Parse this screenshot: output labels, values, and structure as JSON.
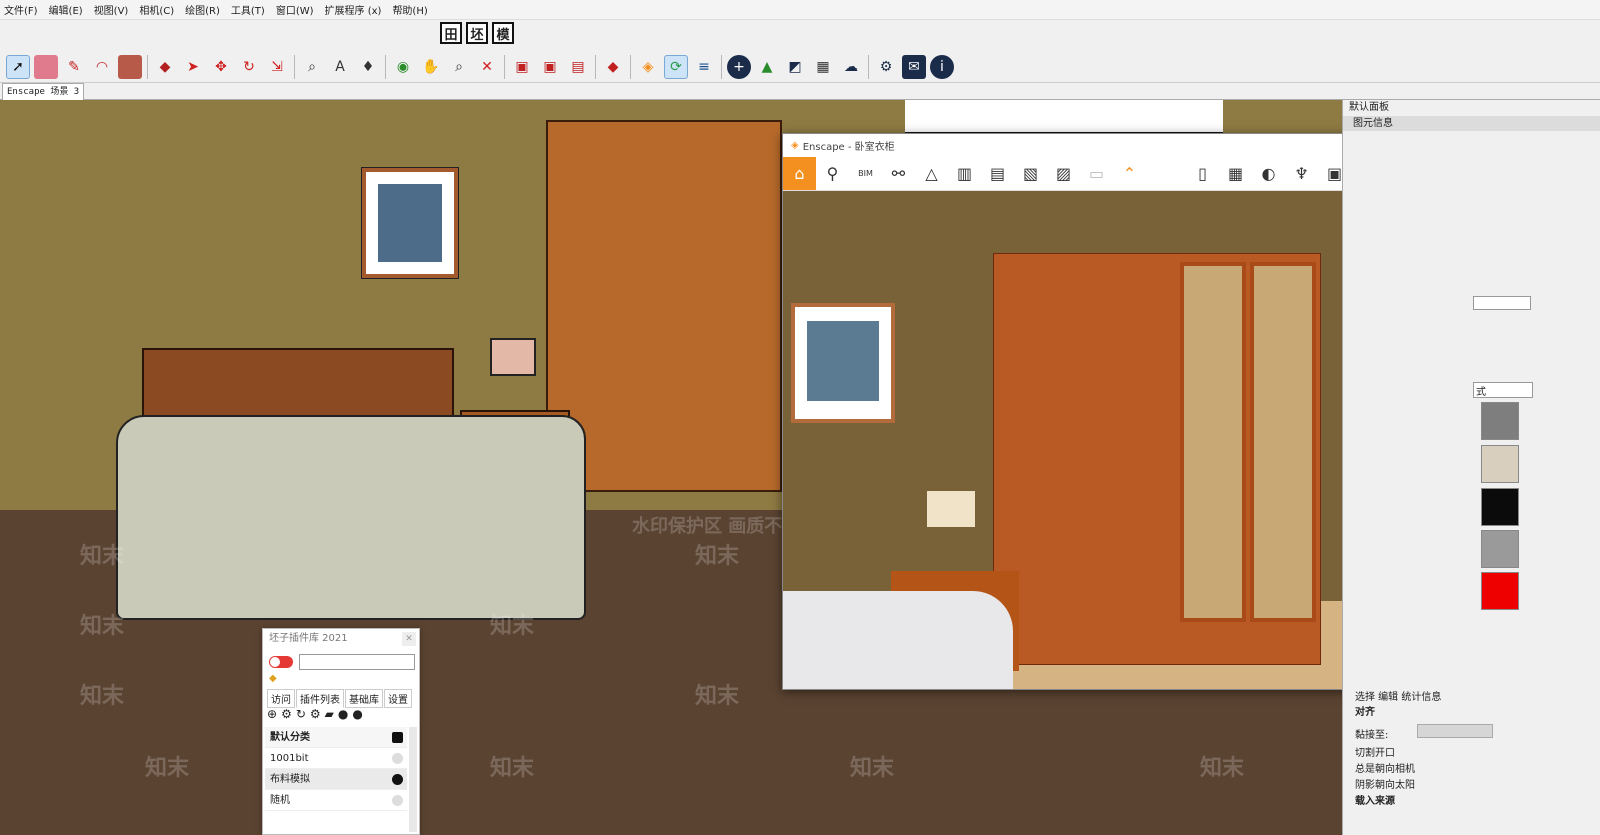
{
  "menu": [
    "文件(F)",
    "编辑(E)",
    "视图(V)",
    "相机(C)",
    "绘图(R)",
    "工具(T)",
    "窗口(W)",
    "扩展程序 (x)",
    "帮助(H)"
  ],
  "small_toolbar": [
    "田",
    "坯",
    "模"
  ],
  "scene_tab": "Enscape 场景 3",
  "watermarks": {
    "main": "水印保护区  画质不受到部分影响",
    "brand": "知末"
  },
  "enscape": {
    "title": "Enscape - 卧室衣柜",
    "bim_label": "BIM",
    "icons": [
      "home-icon",
      "route-icon",
      "bim-icon",
      "binoculars-icon",
      "walk-icon",
      "building-icon",
      "clapper-icon",
      "screenshot-icon",
      "batch-render-icon",
      "pano-icon",
      "map-icon",
      "export-icon",
      "section-icon",
      "asset-icon",
      "asset-library-icon",
      "eye-icon",
      "gear-icon",
      "help-icon"
    ]
  },
  "right_panel": {
    "header": "默认面板",
    "section": "图元信息",
    "tabs": "选择  编辑  统计信息",
    "align": "对齐",
    "glue_to": "黏接至:",
    "cut_opening": "切割开口",
    "face_camera": "总是朝向相机",
    "shadow_sun": "阴影朝向太阳",
    "load_source": "载入来源",
    "style_dropdown": "式",
    "swatch_colors": [
      "#7e7e7e",
      "#d9cfbf",
      "#0b0b0b",
      "#9a9a9a",
      "#ee0000"
    ]
  },
  "plugin": {
    "title": "坯子插件库 2021",
    "tabs": [
      "访问",
      "插件列表",
      "基础库",
      "设置"
    ],
    "list": [
      {
        "label": "默认分类",
        "checked": true
      },
      {
        "label": "1001bit",
        "checked": false
      },
      {
        "label": "布料模拟",
        "checked": true
      },
      {
        "label": "随机",
        "checked": false
      }
    ]
  },
  "colors": {
    "accent": "#f39020",
    "wall": "#8e7a43",
    "floor": "#5b4331"
  }
}
